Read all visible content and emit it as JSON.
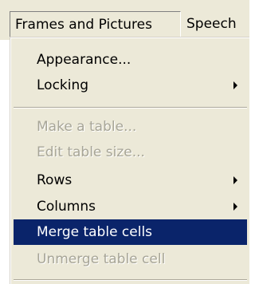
{
  "menubar": {
    "open_menu_label": "Frames and Pictures",
    "next_menu_label": "Speech"
  },
  "menu": {
    "items": [
      {
        "label": "Appearance...",
        "enabled": true,
        "submenu": false
      },
      {
        "label": "Locking",
        "enabled": true,
        "submenu": true
      },
      {
        "label": "Make a table...",
        "enabled": false,
        "submenu": false
      },
      {
        "label": "Edit table size...",
        "enabled": false,
        "submenu": false
      },
      {
        "label": "Rows",
        "enabled": true,
        "submenu": true
      },
      {
        "label": "Columns",
        "enabled": true,
        "submenu": true
      },
      {
        "label": "Merge table cells",
        "enabled": true,
        "submenu": false,
        "highlighted": true
      },
      {
        "label": "Unmerge table cell",
        "enabled": false,
        "submenu": false
      }
    ]
  },
  "colors": {
    "menu_background": "#ece9d8",
    "highlight": "#0a246a",
    "disabled_text": "#a7a597"
  }
}
